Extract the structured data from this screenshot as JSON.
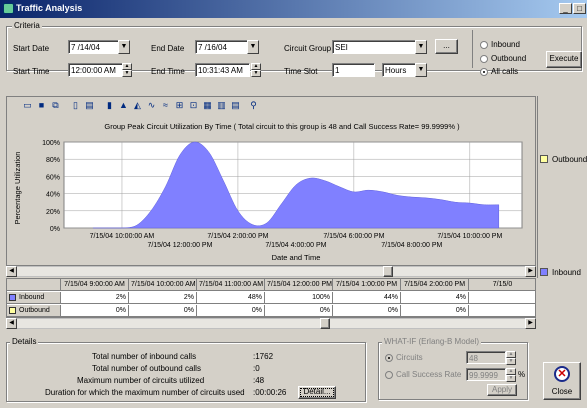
{
  "window": {
    "title": "Traffic Analysis"
  },
  "criteria": {
    "label": "Criteria",
    "start_date_label": "Start Date",
    "start_date": "7 /14/04",
    "end_date_label": "End Date",
    "end_date": "7 /16/04",
    "circuit_group_label": "Circuit Group",
    "circuit_group": "SEI",
    "browse_label": "...",
    "start_time_label": "Start Time",
    "start_time": "12:00:00 AM",
    "end_time_label": "End Time",
    "end_time": "10:31:43 AM",
    "time_slot_label": "Time Slot",
    "time_slot": "1",
    "time_unit": "Hours",
    "radio_inbound": "Inbound",
    "radio_outbound": "Outbound",
    "radio_all": "All calls",
    "selected_radio": "All calls",
    "execute_label": "Execute"
  },
  "legend": {
    "outbound": "Outbound",
    "inbound": "Inbound",
    "outbound_color": "#ffffa0",
    "inbound_color": "#8080ff"
  },
  "chart_data": {
    "type": "area",
    "title": "Group Peak Circuit Utilization By Time ( Total circuit to this group is  48 and Call Success Rate= 99.9999% )",
    "xlabel": "Date and Time",
    "ylabel": "Percentage Utilization",
    "y_ticks": [
      "100%",
      "80%",
      "60%",
      "40%",
      "20%",
      "0%"
    ],
    "ylim": [
      0,
      100
    ],
    "x_ticks_row1": [
      "7/15/04 10:00:00 AM",
      "7/15/04 2:00:00 PM",
      "7/15/04 6:00:00 PM",
      "7/15/04 10:00:00 PM"
    ],
    "x_ticks_row2": [
      "7/15/04 12:00:00 PM",
      "7/15/04 4:00:00 PM",
      "7/15/04 8:00:00 PM"
    ],
    "x_hours": [
      9,
      9.5,
      10,
      10.5,
      11,
      11.5,
      12,
      12.5,
      13,
      13.5,
      14,
      14.5,
      15,
      15.5,
      16,
      16.5,
      17,
      17.5,
      18,
      18.5,
      19,
      19.5,
      20,
      20.5,
      21,
      21.5,
      22,
      22.5,
      23
    ],
    "series": [
      {
        "values": [
          0,
          0,
          0,
          3,
          20,
          48,
          85,
          100,
          88,
          55,
          20,
          4,
          6,
          28,
          50,
          58,
          55,
          48,
          42,
          44,
          42,
          38,
          36,
          35,
          33,
          30,
          29,
          27,
          27
        ],
        "color": "#8080ff"
      }
    ],
    "grid": true
  },
  "table": {
    "headers": [
      "7/15/04 9:00:00 AM",
      "7/15/04 10:00:00 AM",
      "7/15/04 11:00:00 AM",
      "7/15/04 12:00:00 PM",
      "7/15/04 1:00:00 PM",
      "7/15/04 2:00:00 PM",
      "7/15/0"
    ],
    "rows": [
      {
        "label": "Inbound",
        "color": "#8080ff",
        "values": [
          "2%",
          "2%",
          "48%",
          "100%",
          "44%",
          "4%",
          ""
        ]
      },
      {
        "label": "Outbound",
        "color": "#ffffa0",
        "values": [
          "0%",
          "0%",
          "0%",
          "0%",
          "0%",
          "0%",
          ""
        ]
      }
    ]
  },
  "details": {
    "label": "Details",
    "rows": [
      {
        "label": "Total number of inbound calls",
        "value": ":1762"
      },
      {
        "label": "Total number of outbound calls",
        "value": ":0"
      },
      {
        "label": "Maximum number of circuits utilized",
        "value": ":48"
      },
      {
        "label": "Duration for which the maximum number of circuits used",
        "value": ":00:00:26"
      }
    ],
    "detail_button": "Detail..."
  },
  "whatif": {
    "label": "WHAT-IF (Erlang-B Model)",
    "circuits_label": "Circuits",
    "circuits_value": "48",
    "success_label": "Call Success Rate",
    "success_value": "99.9999",
    "success_unit": "%",
    "apply_label": "Apply"
  },
  "close_label": "Close"
}
